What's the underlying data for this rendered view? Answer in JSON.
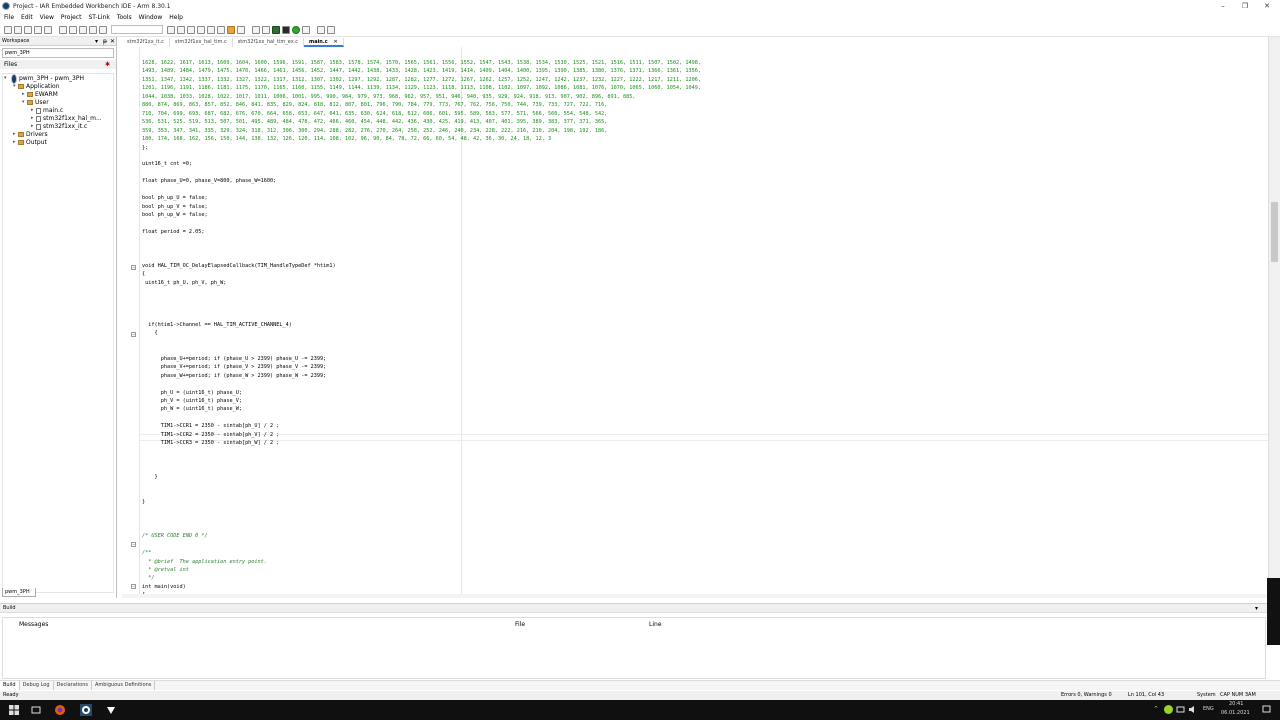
{
  "window": {
    "title": "Project - IAR Embedded Workbench IDE - Arm 8.30.1",
    "minimize": "–",
    "maximize": "❐",
    "close": "✕"
  },
  "menu": [
    "File",
    "Edit",
    "View",
    "Project",
    "ST-Link",
    "Tools",
    "Window",
    "Help"
  ],
  "doc_tabs": [
    {
      "label": "stm32f1xx_it.c",
      "active": false
    },
    {
      "label": "stm32f1xx_hal_tim.c",
      "active": false
    },
    {
      "label": "stm32f1xx_hal_tim_ex.c",
      "active": false
    },
    {
      "label": "main.c",
      "active": true
    }
  ],
  "doc_tab_close": "✕",
  "workspace": {
    "title": "Workspace",
    "pin": "▾",
    "dock": "ᵽ",
    "close": "✕",
    "project_combo": "pwm_3PH",
    "files_header": "Files",
    "files_marker": "✱",
    "footer_tab": "pwm_3PH",
    "tree": [
      {
        "label": "pwm_3PH - pwm_3PH",
        "level": 0,
        "icon": "project",
        "expander": "▾"
      },
      {
        "label": "Application",
        "level": 1,
        "icon": "folder",
        "expander": "▾"
      },
      {
        "label": "EWARM",
        "level": 2,
        "icon": "folder",
        "expander": "▸"
      },
      {
        "label": "User",
        "level": 2,
        "icon": "folder",
        "expander": "▾"
      },
      {
        "label": "main.c",
        "level": 3,
        "icon": "file",
        "expander": "▸"
      },
      {
        "label": "stm32f1xx_hal_m...",
        "level": 3,
        "icon": "file",
        "expander": "▸"
      },
      {
        "label": "stm32f1xx_it.c",
        "level": 3,
        "icon": "file",
        "expander": "▸"
      },
      {
        "label": "Drivers",
        "level": 1,
        "icon": "folder",
        "expander": "▸"
      },
      {
        "label": "Output",
        "level": 1,
        "icon": "folder",
        "expander": "▸"
      }
    ]
  },
  "code_lines": [
    {
      "text": "1628, 1622, 1617, 1613, 1609, 1604, 1600, 1596, 1591, 1587, 1583, 1578, 1574, 1570, 1565, 1561, 1556, 1552, 1547, 1543, 1538, 1534, 1530, 1525, 1521, 1516, 1511, 1507, 1502, 1498,",
      "kind": "num"
    },
    {
      "text": "1493, 1489, 1484, 1479, 1475, 1470, 1466, 1461, 1456, 1452, 1447, 1442, 1438, 1433, 1428, 1423, 1419, 1414, 1409, 1404, 1400, 1395, 1390, 1385, 1380, 1376, 1371, 1366, 1361, 1356,",
      "kind": "num"
    },
    {
      "text": "1351, 1347, 1342, 1337, 1332, 1327, 1322, 1317, 1312, 1307, 1302, 1297, 1292, 1287, 1282, 1277, 1272, 1267, 1262, 1257, 1252, 1247, 1242, 1237, 1232, 1227, 1222, 1217, 1211, 1206,",
      "kind": "num"
    },
    {
      "text": "1201, 1196, 1191, 1186, 1181, 1175, 1170, 1165, 1160, 1155, 1149, 1144, 1139, 1134, 1129, 1123, 1118, 1113, 1108, 1102, 1097, 1092, 1086, 1081, 1076, 1070, 1065, 1060, 1054, 1049,",
      "kind": "num"
    },
    {
      "text": "1044, 1038, 1033, 1028, 1022, 1017, 1011, 1006, 1001, 995, 990, 984, 979, 973, 968, 962, 957, 951, 946, 940, 935, 929, 924, 918, 913, 907, 902, 896, 891, 885,",
      "kind": "num"
    },
    {
      "text": "880, 874, 869, 863, 857, 852, 846, 841, 835, 829, 824, 818, 812, 807, 801, 796, 790, 784, 779, 773, 767, 762, 756, 750, 744, 739, 733, 727, 722, 716,",
      "kind": "num"
    },
    {
      "text": "710, 704, 699, 693, 687, 682, 676, 670, 664, 658, 653, 647, 641, 635, 630, 624, 618, 612, 606, 601, 595, 589, 583, 577, 571, 566, 560, 554, 548, 542,",
      "kind": "num"
    },
    {
      "text": "536, 531, 525, 519, 513, 507, 501, 495, 489, 484, 478, 472, 466, 460, 454, 448, 442, 436, 430, 425, 419, 413, 407, 401, 395, 389, 383, 377, 371, 365,",
      "kind": "num"
    },
    {
      "text": "359, 353, 347, 341, 335, 329, 324, 318, 312, 306, 300, 294, 288, 282, 276, 270, 264, 258, 252, 246, 240, 234, 228, 222, 216, 210, 204, 198, 192, 186,",
      "kind": "num"
    },
    {
      "text": "180, 174, 168, 162, 156, 150, 144, 138, 132, 126, 120, 114, 108, 102, 96, 90, 84, 78, 72, 66, 60, 54, 48, 42, 36, 30, 24, 18, 12, 3",
      "kind": "num"
    },
    {
      "text": "};",
      "kind": "code"
    },
    {
      "text": "",
      "kind": "code"
    },
    {
      "text": "uint16_t cnt =0;",
      "kind": "code"
    },
    {
      "text": "",
      "kind": "code"
    },
    {
      "text": "float phase_U=0, phase_V=800, phase_W=1600;",
      "kind": "code"
    },
    {
      "text": "",
      "kind": "code"
    },
    {
      "text": "bool ph_up_U = false;",
      "kind": "code"
    },
    {
      "text": "bool ph_up_V = false;",
      "kind": "code"
    },
    {
      "text": "bool ph_up_W = false;",
      "kind": "code"
    },
    {
      "text": "",
      "kind": "code"
    },
    {
      "text": "float period = 2.05;",
      "kind": "code"
    },
    {
      "text": "",
      "kind": "code"
    },
    {
      "text": "",
      "kind": "code"
    },
    {
      "text": "",
      "kind": "code"
    },
    {
      "text": "void HAL_TIM_OC_DelayElapsedCallback(TIM_HandleTypeDef *htim1)",
      "kind": "code"
    },
    {
      "text": "{",
      "kind": "code"
    },
    {
      "text": " uint16_t ph_U, ph_V, ph_W;",
      "kind": "code"
    },
    {
      "text": "",
      "kind": "code"
    },
    {
      "text": "",
      "kind": "code"
    },
    {
      "text": "",
      "kind": "code"
    },
    {
      "text": "",
      "kind": "code"
    },
    {
      "text": "  if(htim1->Channel == HAL_TIM_ACTIVE_CHANNEL_4)",
      "kind": "code"
    },
    {
      "text": "    {",
      "kind": "code"
    },
    {
      "text": "",
      "kind": "code"
    },
    {
      "text": "",
      "kind": "code"
    },
    {
      "text": "      phase_U+=period; if (phase_U > 2399) phase_U -= 2399;",
      "kind": "code"
    },
    {
      "text": "      phase_V+=period; if (phase_V > 2399) phase_V -= 2399;",
      "kind": "code"
    },
    {
      "text": "      phase_W+=period; if (phase_W > 2399) phase_W -= 2399;",
      "kind": "code"
    },
    {
      "text": "",
      "kind": "code"
    },
    {
      "text": "      ph_U = (uint16_t) phase_U;",
      "kind": "code"
    },
    {
      "text": "      ph_V = (uint16_t) phase_V;",
      "kind": "code"
    },
    {
      "text": "      ph_W = (uint16_t) phase_W;",
      "kind": "code"
    },
    {
      "text": "",
      "kind": "code"
    },
    {
      "text": "      TIM1->CCR1 = 2350 - sintab[ph_U] / 2 ;",
      "kind": "code"
    },
    {
      "text": "      TIM1->CCR2 = 2350 - sintab[ph_V] / 2 ;",
      "kind": "code"
    },
    {
      "text": "      TIM1->CCR3 = 2350 - sintab[ph_W] / 2 ;",
      "kind": "code"
    },
    {
      "text": "",
      "kind": "code"
    },
    {
      "text": "",
      "kind": "code"
    },
    {
      "text": "",
      "kind": "code"
    },
    {
      "text": "    }",
      "kind": "code"
    },
    {
      "text": "",
      "kind": "code"
    },
    {
      "text": "",
      "kind": "code"
    },
    {
      "text": "}",
      "kind": "code"
    },
    {
      "text": "",
      "kind": "code"
    },
    {
      "text": "",
      "kind": "code"
    },
    {
      "text": "",
      "kind": "code"
    },
    {
      "text": "/* USER CODE END 0 */",
      "kind": "cmt"
    },
    {
      "text": "",
      "kind": "code"
    },
    {
      "text": "/**",
      "kind": "cmt"
    },
    {
      "text": "  * @brief  The application entry point.",
      "kind": "cmt"
    },
    {
      "text": "  * @retval int",
      "kind": "cmt"
    },
    {
      "text": "  */",
      "kind": "cmt"
    },
    {
      "text": "int main(void)",
      "kind": "code"
    },
    {
      "text": "{",
      "kind": "code"
    }
  ],
  "build": {
    "title": "Build",
    "pin": "▾",
    "close": "✕",
    "col_messages": "Messages",
    "col_file": "File",
    "col_line": "Line"
  },
  "bottom_tabs": [
    {
      "label": "Build",
      "active": true
    },
    {
      "label": "Debug Log",
      "active": false
    },
    {
      "label": "Declarations",
      "active": false
    },
    {
      "label": "Ambiguous Definitions",
      "active": false
    }
  ],
  "status": {
    "ready": "Ready",
    "errors": "Errors 0, Warnings 0",
    "position": "Ln 101, Col 43",
    "encoding": "System",
    "keys": "CAP  NUM  ЗАМ"
  },
  "tray": {
    "chevron": "^",
    "lang": "ENG",
    "time": "20:41",
    "date": "06.01.2021"
  }
}
